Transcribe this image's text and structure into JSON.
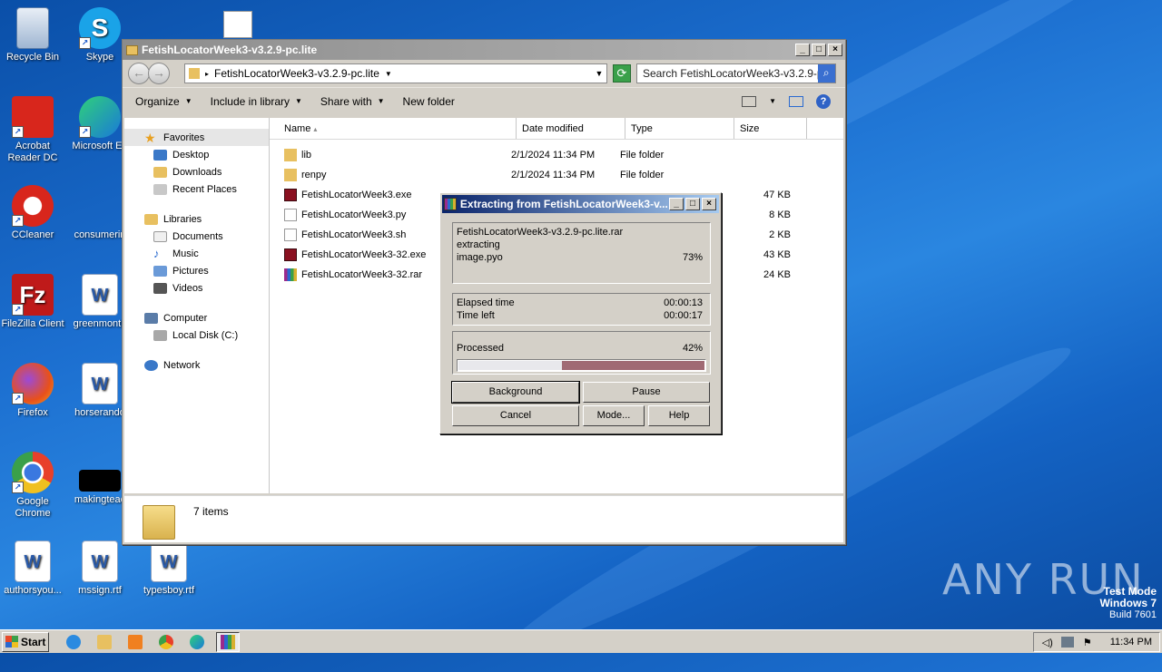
{
  "desktop": {
    "icons": [
      {
        "label": "Recycle Bin"
      },
      {
        "label": "Skype"
      },
      {
        "label": "Acrobat Reader DC"
      },
      {
        "label": "Microsoft Ed"
      },
      {
        "label": "CCleaner"
      },
      {
        "label": "consumerin"
      },
      {
        "label": "FileZilla Client"
      },
      {
        "label": "greenmonth"
      },
      {
        "label": "Firefox"
      },
      {
        "label": "horserando"
      },
      {
        "label": "Google Chrome"
      },
      {
        "label": "makingteac"
      },
      {
        "label": "authorsyou..."
      },
      {
        "label": "mssign.rtf"
      },
      {
        "label": "typesboy.rtf"
      }
    ]
  },
  "explorer": {
    "title": "FetishLocatorWeek3-v3.2.9-pc.lite",
    "address": "FetishLocatorWeek3-v3.2.9-pc.lite",
    "search_placeholder": "Search FetishLocatorWeek3-v3.2.9-pc....",
    "commands": [
      "Organize",
      "Include in library",
      "Share with",
      "New folder"
    ],
    "nav": {
      "favorites": "Favorites",
      "favorites_items": [
        "Desktop",
        "Downloads",
        "Recent Places"
      ],
      "libraries": "Libraries",
      "libraries_items": [
        "Documents",
        "Music",
        "Pictures",
        "Videos"
      ],
      "computer": "Computer",
      "computer_items": [
        "Local Disk (C:)"
      ],
      "network": "Network"
    },
    "columns": [
      "Name",
      "Date modified",
      "Type",
      "Size"
    ],
    "files": [
      {
        "name": "lib",
        "date": "2/1/2024 11:34 PM",
        "type": "File folder",
        "size": "",
        "kind": "folder"
      },
      {
        "name": "renpy",
        "date": "2/1/2024 11:34 PM",
        "type": "File folder",
        "size": "",
        "kind": "folder"
      },
      {
        "name": "FetishLocatorWeek3.exe",
        "date": "",
        "type": "",
        "size": "47 KB",
        "kind": "exe"
      },
      {
        "name": "FetishLocatorWeek3.py",
        "date": "",
        "type": "",
        "size": "8 KB",
        "kind": "doc"
      },
      {
        "name": "FetishLocatorWeek3.sh",
        "date": "",
        "type": "",
        "size": "2 KB",
        "kind": "doc"
      },
      {
        "name": "FetishLocatorWeek3-32.exe",
        "date": "",
        "type": "",
        "size": "43 KB",
        "kind": "exe"
      },
      {
        "name": "FetishLocatorWeek3-32.rar",
        "date": "",
        "type": "",
        "size": "24 KB",
        "kind": "rar"
      }
    ],
    "status": "7 items"
  },
  "dialog": {
    "title": "Extracting from FetishLocatorWeek3-v...",
    "archive": "FetishLocatorWeek3-v3.2.9-pc.lite.rar",
    "action": "extracting",
    "current_file": "image.pyo",
    "file_percent": "73%",
    "elapsed_label": "Elapsed time",
    "elapsed_value": "00:00:13",
    "left_label": "Time left",
    "left_value": "00:00:17",
    "processed_label": "Processed",
    "processed_percent": "42%",
    "processed_fraction": 0.42,
    "buttons": {
      "background": "Background",
      "pause": "Pause",
      "cancel": "Cancel",
      "mode": "Mode...",
      "help": "Help"
    }
  },
  "taskbar": {
    "start": "Start",
    "clock": "11:34 PM"
  },
  "watermark": {
    "line1": "Test Mode",
    "line2": "Windows 7",
    "line3": "Build 7601",
    "brand": "ANY RUN"
  }
}
